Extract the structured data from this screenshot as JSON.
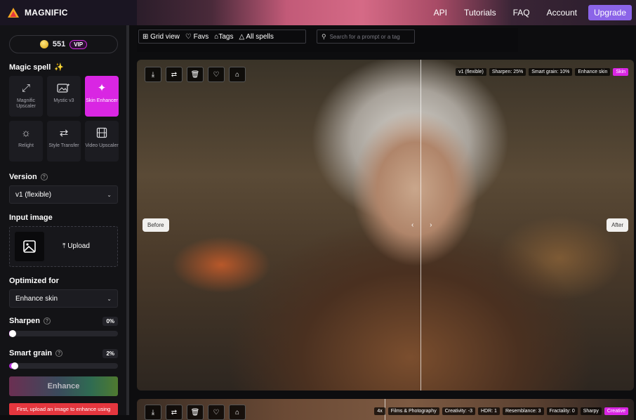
{
  "app": {
    "name": "MAGNIFIC"
  },
  "nav": {
    "api": "API",
    "tutorials": "Tutorials",
    "faq": "FAQ",
    "account": "Account",
    "upgrade": "Upgrade"
  },
  "sidebar": {
    "credits": "551",
    "vip": "VIP",
    "magic_spell_title": "Magic spell",
    "spells": [
      {
        "label": "Magnific Upscaler",
        "icon": "arrows-expand-icon",
        "active": false
      },
      {
        "label": "Mystic v3",
        "icon": "image-sparkle-icon",
        "active": false
      },
      {
        "label": "Skin Enhancer",
        "icon": "sparkles-icon",
        "active": true
      },
      {
        "label": "Relight",
        "icon": "sun-icon",
        "active": false
      },
      {
        "label": "Style Transfer",
        "icon": "transfer-icon",
        "active": false
      },
      {
        "label": "Video Upscaler",
        "icon": "film-icon",
        "active": false
      }
    ],
    "version_title": "Version",
    "version_value": "v1 (flexible)",
    "input_title": "Input image",
    "upload_label": "Upload",
    "optimized_title": "Optimized for",
    "optimized_value": "Enhance skin",
    "sharpen_title": "Sharpen",
    "sharpen_value": "0%",
    "sharpen_level": 0,
    "grain_title": "Smart grain",
    "grain_value": "2%",
    "grain_level": 2,
    "enhance_label": "Enhance",
    "warning": "First, upload an image to enhance using"
  },
  "toolbar": {
    "grid_view": "Grid view",
    "favs": "Favs",
    "tags": "Tags",
    "all_spells": "All spells",
    "search_placeholder": "Search for a prompt or a tag"
  },
  "card1": {
    "tags": [
      "v1 (flexible)",
      "Sharpen: 25%",
      "Smart grain: 10%",
      "Enhance skin",
      "Skin"
    ],
    "before": "Before",
    "after": "After",
    "split_handle": "‹ ›"
  },
  "card2": {
    "tags": [
      "4x",
      "Films & Photography",
      "Creativity: -3",
      "HDR: 1",
      "Resemblance: 3",
      "Fractality: 0",
      "Sharpy",
      "Creative"
    ]
  },
  "colors": {
    "accent": "#d926e3",
    "upgrade": "#8b64e8",
    "warning": "#e5363e"
  }
}
